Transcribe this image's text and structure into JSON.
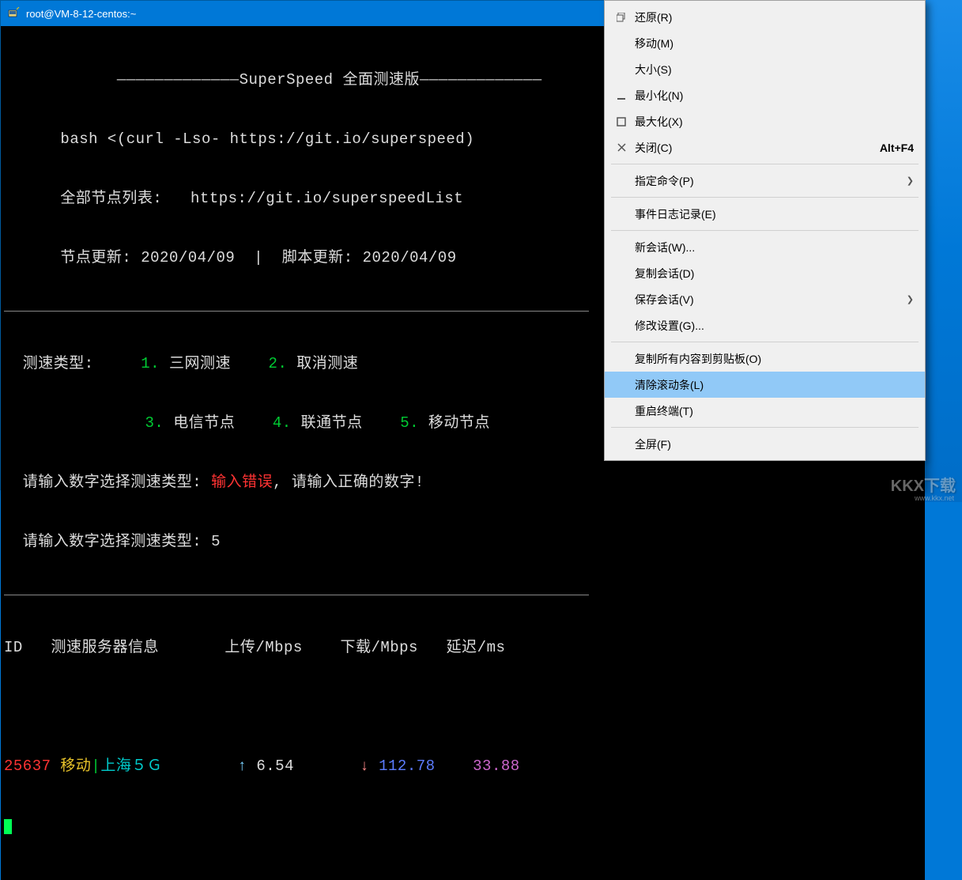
{
  "window": {
    "title": "root@VM-8-12-centos:~"
  },
  "terminal": {
    "header": {
      "title_prefix": "—————————————",
      "title": "SuperSpeed 全面测速版",
      "title_suffix": "—————————————",
      "bash_line": "bash <(curl -Lso- https://git.io/superspeed)",
      "nodes_label": "全部节点列表:   ",
      "nodes_value": "https://git.io/superspeedList",
      "update_label": "节点更新: ",
      "update_value": "2020/04/09",
      "script_update_label": "  |  脚本更新: ",
      "script_update_value": "2020/04/09"
    },
    "options": {
      "type_label": "  测速类型: ",
      "item1_num": "    1. ",
      "item1": "三网测速",
      "item2_num": "    2. ",
      "item2": "取消测速",
      "item3_num": "               3. ",
      "item3": "电信节点",
      "item4_num": "    4. ",
      "item4": "联通节点",
      "item5_num": "    5. ",
      "item5": "移动节点"
    },
    "prompt": {
      "error_prefix": "  请输入数字选择测速类型: ",
      "error": "输入错误",
      "error_suffix": ", 请输入正确的数字!",
      "again": "  请输入数字选择测速类型: 5"
    },
    "table": {
      "h_id": "ID  ",
      "h_server": " 测速服务器信息",
      "h_upload": "       上传/Mbps",
      "h_download": "    下载/Mbps",
      "h_latency": "   延迟/ms",
      "row1": {
        "id": "25637",
        "carrier": " 移动",
        "sep": "|",
        "loc": "上海５Ｇ",
        "up": "6.54",
        "down": "112.78",
        "lat": "33.88"
      }
    }
  },
  "context_menu": {
    "items": [
      {
        "icon": "restore",
        "label": "还原(R)",
        "shortcut": "",
        "sub": false
      },
      {
        "icon": "",
        "label": "移动(M)",
        "shortcut": "",
        "sub": false
      },
      {
        "icon": "",
        "label": "大小(S)",
        "shortcut": "",
        "sub": false
      },
      {
        "icon": "minimize",
        "label": "最小化(N)",
        "shortcut": "",
        "sub": false
      },
      {
        "icon": "maximize",
        "label": "最大化(X)",
        "shortcut": "",
        "sub": false
      },
      {
        "icon": "close",
        "label": "关闭(C)",
        "shortcut": "Alt+F4",
        "sub": false
      },
      {
        "sep": true
      },
      {
        "icon": "",
        "label": "指定命令(P)",
        "shortcut": "",
        "sub": true
      },
      {
        "sep": true
      },
      {
        "icon": "",
        "label": "事件日志记录(E)",
        "shortcut": "",
        "sub": false
      },
      {
        "sep": true
      },
      {
        "icon": "",
        "label": "新会话(W)...",
        "shortcut": "",
        "sub": false
      },
      {
        "icon": "",
        "label": "复制会话(D)",
        "shortcut": "",
        "sub": false
      },
      {
        "icon": "",
        "label": "保存会话(V)",
        "shortcut": "",
        "sub": true
      },
      {
        "icon": "",
        "label": "修改设置(G)...",
        "shortcut": "",
        "sub": false
      },
      {
        "sep": true
      },
      {
        "icon": "",
        "label": "复制所有内容到剪贴板(O)",
        "shortcut": "",
        "sub": false
      },
      {
        "icon": "",
        "label": "清除滚动条(L)",
        "shortcut": "",
        "sub": false,
        "hover": true
      },
      {
        "icon": "",
        "label": "重启终端(T)",
        "shortcut": "",
        "sub": false
      },
      {
        "sep": true
      },
      {
        "icon": "",
        "label": "全屏(F)",
        "shortcut": "",
        "sub": false
      }
    ]
  },
  "watermark": "KKX下载",
  "watermark_sub": "www.kkx.net"
}
